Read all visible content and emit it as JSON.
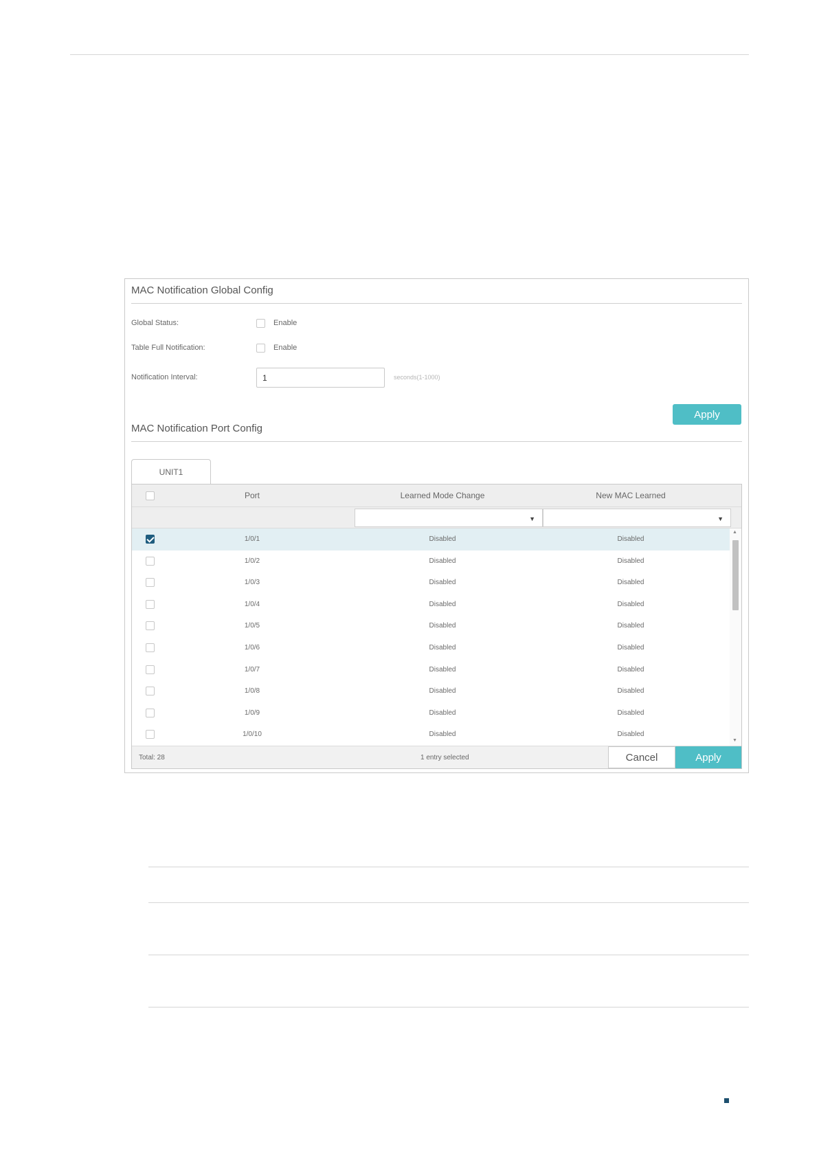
{
  "global_config": {
    "title": "MAC Notification Global Config",
    "global_status_label": "Global Status:",
    "global_status_enable": "Enable",
    "table_full_label": "Table Full Notification:",
    "table_full_enable": "Enable",
    "interval_label": "Notification Interval:",
    "interval_value": "1",
    "interval_hint": "seconds(1-1000)",
    "apply_label": "Apply"
  },
  "port_config": {
    "title": "MAC Notification Port Config",
    "tab_label": "UNIT1",
    "columns": [
      "Port",
      "Learned Mode Change",
      "New MAC Learned"
    ],
    "rows": [
      {
        "port": "1/0/1",
        "learned_mode_change": "Disabled",
        "new_mac_learned": "Disabled",
        "selected": true
      },
      {
        "port": "1/0/2",
        "learned_mode_change": "Disabled",
        "new_mac_learned": "Disabled",
        "selected": false
      },
      {
        "port": "1/0/3",
        "learned_mode_change": "Disabled",
        "new_mac_learned": "Disabled",
        "selected": false
      },
      {
        "port": "1/0/4",
        "learned_mode_change": "Disabled",
        "new_mac_learned": "Disabled",
        "selected": false
      },
      {
        "port": "1/0/5",
        "learned_mode_change": "Disabled",
        "new_mac_learned": "Disabled",
        "selected": false
      },
      {
        "port": "1/0/6",
        "learned_mode_change": "Disabled",
        "new_mac_learned": "Disabled",
        "selected": false
      },
      {
        "port": "1/0/7",
        "learned_mode_change": "Disabled",
        "new_mac_learned": "Disabled",
        "selected": false
      },
      {
        "port": "1/0/8",
        "learned_mode_change": "Disabled",
        "new_mac_learned": "Disabled",
        "selected": false
      },
      {
        "port": "1/0/9",
        "learned_mode_change": "Disabled",
        "new_mac_learned": "Disabled",
        "selected": false
      },
      {
        "port": "1/0/10",
        "learned_mode_change": "Disabled",
        "new_mac_learned": "Disabled",
        "selected": false
      }
    ],
    "total_label": "Total: 28",
    "selected_label": "1 entry selected",
    "cancel_label": "Cancel",
    "apply_label": "Apply"
  },
  "colors": {
    "accent": "#4fbec6",
    "checked": "#1f5d7f",
    "selected_row": "#e2eff3"
  },
  "icons": {
    "dropdown": "chevron-down-icon",
    "scroll_up": "arrow-up-icon",
    "scroll_down": "arrow-down-icon",
    "checkbox_checked": "checkmark-icon"
  }
}
